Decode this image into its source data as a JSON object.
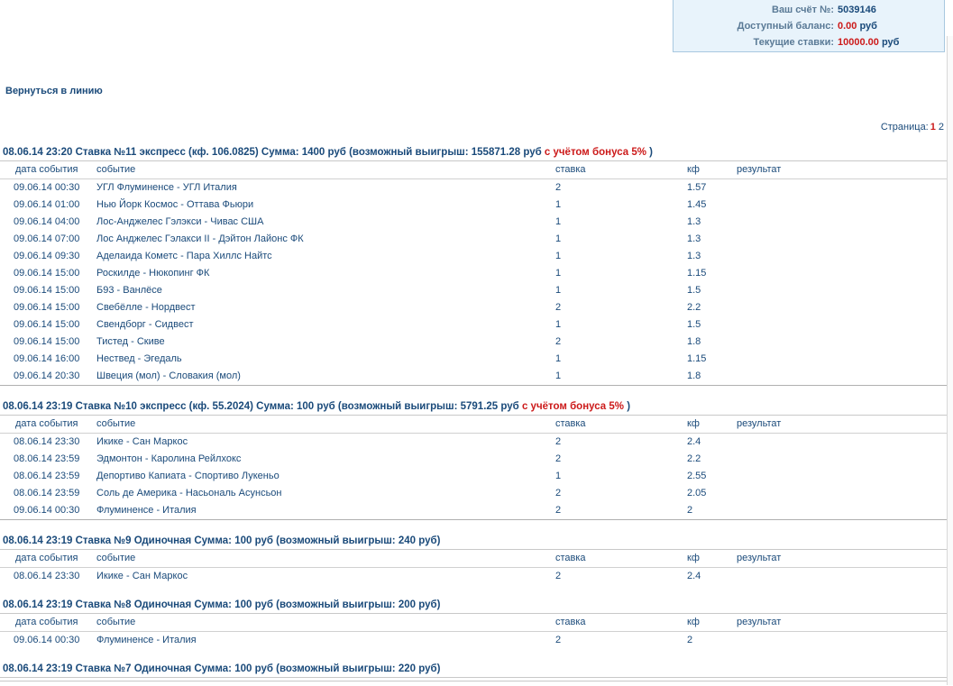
{
  "account": {
    "number_label": "Ваш счёт №:",
    "number_value": "5039146",
    "balance_label": "Доступный баланс:",
    "balance_value": "0.00",
    "balance_unit": "руб",
    "current_label": "Текущие ставки:",
    "current_value": "10000.00",
    "current_unit": "руб"
  },
  "nav": {
    "back_label": "Вернуться в линию"
  },
  "pager": {
    "label": "Страница:",
    "current": "1",
    "other": "2"
  },
  "columns": {
    "date": "дата события",
    "event": "событие",
    "bet": "ставка",
    "kf": "кф",
    "result": "результат"
  },
  "bets": [
    {
      "head": "08.06.14 23:20  Ставка №11  экспресс (кф. 106.0825)   Сумма: 1400 руб (возможный выигрыш: 155871.28 руб ",
      "bonus": "с учётом бонуса 5%",
      "close": " )",
      "rows": [
        {
          "date": "09.06.14 00:30",
          "event": "УГЛ Флуминенсе - УГЛ Италия",
          "bet": "2",
          "kf": "1.57"
        },
        {
          "date": "09.06.14 01:00",
          "event": "Нью Йорк Космос - Оттава Фьюри",
          "bet": "1",
          "kf": "1.45"
        },
        {
          "date": "09.06.14 04:00",
          "event": "Лос-Анджелес Гэлэкси - Чивас США",
          "bet": "1",
          "kf": "1.3"
        },
        {
          "date": "09.06.14 07:00",
          "event": "Лос Анджелес Гэлакси II - Дэйтон Лайонс ФК",
          "bet": "1",
          "kf": "1.3"
        },
        {
          "date": "09.06.14 09:30",
          "event": "Аделаида Кометс - Пара Хиллс Найтс",
          "bet": "1",
          "kf": "1.3"
        },
        {
          "date": "09.06.14 15:00",
          "event": "Роскилде - Нюкопинг ФК",
          "bet": "1",
          "kf": "1.15"
        },
        {
          "date": "09.06.14 15:00",
          "event": "Б93 - Ванлёсе",
          "bet": "1",
          "kf": "1.5"
        },
        {
          "date": "09.06.14 15:00",
          "event": "Свебёлле - Нордвест",
          "bet": "2",
          "kf": "2.2"
        },
        {
          "date": "09.06.14 15:00",
          "event": "Свендборг - Сидвест",
          "bet": "1",
          "kf": "1.5"
        },
        {
          "date": "09.06.14 15:00",
          "event": "Тистед - Скиве",
          "bet": "2",
          "kf": "1.8"
        },
        {
          "date": "09.06.14 16:00",
          "event": "Нествед - Эгедаль",
          "bet": "1",
          "kf": "1.15"
        },
        {
          "date": "09.06.14 20:30",
          "event": "Швеция (мол) - Словакия (мол)",
          "bet": "1",
          "kf": "1.8"
        }
      ]
    },
    {
      "head": "08.06.14 23:19  Ставка №10  экспресс (кф. 55.2024)   Сумма: 100 руб (возможный выигрыш: 5791.25 руб ",
      "bonus": "с учётом бонуса 5%",
      "close": " )",
      "rows": [
        {
          "date": "08.06.14 23:30",
          "event": "Икике - Сан Маркос",
          "bet": "2",
          "kf": "2.4"
        },
        {
          "date": "08.06.14 23:59",
          "event": "Эдмонтон - Каролина Рейлхокс",
          "bet": "2",
          "kf": "2.2"
        },
        {
          "date": "08.06.14 23:59",
          "event": "Депортиво Капиата - Спортиво Лукеньо",
          "bet": "1",
          "kf": "2.55"
        },
        {
          "date": "08.06.14 23:59",
          "event": "Соль де Америка - Насьональ Асунсьон",
          "bet": "2",
          "kf": "2.05"
        },
        {
          "date": "09.06.14 00:30",
          "event": "Флуминенсе - Италия",
          "bet": "2",
          "kf": "2"
        }
      ]
    },
    {
      "head": "08.06.14 23:19  Ставка №9  Одиночная  Сумма: 100 руб (возможный выигрыш: 240 руб)",
      "bonus": "",
      "close": "",
      "rows": [
        {
          "date": "08.06.14 23:30",
          "event": "Икике - Сан Маркос",
          "bet": "2",
          "kf": "2.4"
        }
      ]
    },
    {
      "head": "08.06.14 23:19  Ставка №8  Одиночная  Сумма: 100 руб (возможный выигрыш: 200 руб)",
      "bonus": "",
      "close": "",
      "rows": [
        {
          "date": "09.06.14 00:30",
          "event": "Флуминенсе - Италия",
          "bet": "2",
          "kf": "2"
        }
      ]
    },
    {
      "head": "08.06.14 23:19  Ставка №7  Одиночная  Сумма: 100 руб (возможный выигрыш: 220 руб)",
      "bonus": "",
      "close": "",
      "rows": []
    }
  ]
}
